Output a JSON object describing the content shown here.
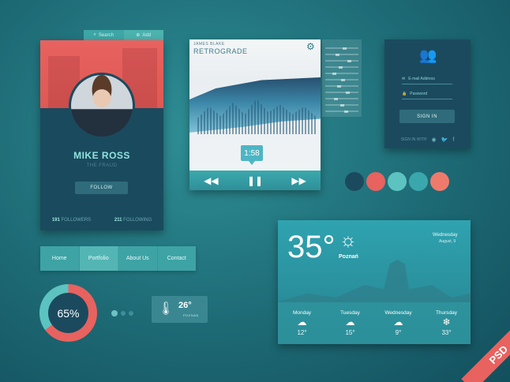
{
  "profile": {
    "tabs": [
      {
        "icon": "search-icon",
        "label": "Search"
      },
      {
        "icon": "add-icon",
        "label": "Add"
      }
    ],
    "name": "MIKE ROSS",
    "role": "THE FRAUD",
    "follow_label": "FOLLOW",
    "followers_count": "191",
    "followers_label": "FOLLOWERS",
    "following_count": "211",
    "following_label": "FOLLOWING"
  },
  "player": {
    "artist": "JAMES BLAKE",
    "song": "RETROGRADE",
    "time": "1:58",
    "controls": {
      "prev": "rewind-icon",
      "play": "pause-icon",
      "next": "fast-forward-icon"
    }
  },
  "equalizer_levels": [
    0.6,
    0.35,
    0.75,
    0.45,
    0.25,
    0.55,
    0.4,
    0.7,
    0.3,
    0.5,
    0.65
  ],
  "login": {
    "email_placeholder": "E-mail Address",
    "password_placeholder": "Password",
    "signin_label": "SIGN IN",
    "social_label": "SIGN IN WITH",
    "social_icons": [
      "github-icon",
      "twitter-icon",
      "facebook-icon"
    ]
  },
  "swatches": [
    "#1b4a5e",
    "#e8625f",
    "#5cc3c1",
    "#3aa7ac",
    "#ee7a6c"
  ],
  "nav": {
    "items": [
      {
        "label": "Home",
        "active": false
      },
      {
        "label": "Portfolio",
        "active": true
      },
      {
        "label": "About Us",
        "active": false
      },
      {
        "label": "Contact",
        "active": false
      }
    ]
  },
  "donut": {
    "value": 65,
    "label": "65%",
    "colors": {
      "progress": "#e8625f",
      "rest": "#5cc3c1"
    }
  },
  "temp_widget": {
    "value": "26°",
    "city": "POZNAN"
  },
  "weather": {
    "temperature": "35°",
    "city": "Poznań",
    "day": "Wednesday",
    "date": "August, 9",
    "forecast": [
      {
        "day": "Monday",
        "icon": "rain-cloud-icon",
        "temp": "12°"
      },
      {
        "day": "Tuesday",
        "icon": "rain-cloud-icon",
        "temp": "15°"
      },
      {
        "day": "Wednesday",
        "icon": "storm-cloud-icon",
        "temp": "9°"
      },
      {
        "day": "Thursday",
        "icon": "snow-icon",
        "temp": "33°"
      }
    ]
  },
  "badge": "PSD"
}
